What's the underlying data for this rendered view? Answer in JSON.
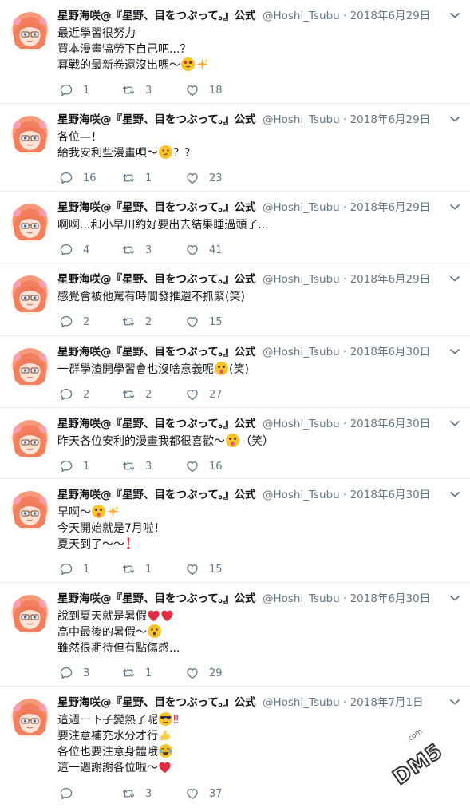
{
  "account": {
    "name": "星野海咲@『星野、目をつぶって。』公式",
    "handle": "@Hoshi_Tsubu",
    "separator": "·"
  },
  "tweets": [
    {
      "date": "2018年6月29日",
      "lines": [
        "最近學習很努力",
        "買本漫畫犒勞下自己吧...？",
        "暮戰的最新卷還沒出嗎～"
      ],
      "line_emojis": [
        [],
        [],
        [
          "heart-eyes-emoji",
          "sparkles-emoji"
        ]
      ],
      "replies": "1",
      "retweets": "3",
      "likes": "18"
    },
    {
      "date": "2018年6月29日",
      "lines": [
        "各位—！",
        "給我安利些漫畫唄～",
        "？？"
      ],
      "replies": "16",
      "retweets": "1",
      "likes": "23"
    },
    {
      "date": "2018年6月29日",
      "lines": [
        "啊啊...和小早川約好要出去結果睡過頭了..."
      ],
      "replies": "4",
      "retweets": "3",
      "likes": "41"
    },
    {
      "date": "2018年6月29日",
      "lines": [
        "感覺會被他罵有時間發推還不抓緊(笑)"
      ],
      "replies": "2",
      "retweets": "2",
      "likes": "15"
    },
    {
      "date": "2018年6月30日",
      "lines": [
        "一群學渣開學習會也沒啥意義呢",
        "(笑)"
      ],
      "replies": "2",
      "retweets": "2",
      "likes": "27"
    },
    {
      "date": "2018年6月30日",
      "lines": [
        "昨天各位安利的漫畫我都很喜歡～",
        "（笑）"
      ],
      "replies": "1",
      "retweets": "3",
      "likes": "16"
    },
    {
      "date": "2018年6月30日",
      "lines": [
        "早啊～",
        "今天開始就是7月啦！",
        "夏天到了～～"
      ],
      "replies": "1",
      "retweets": "1",
      "likes": "15"
    },
    {
      "date": "2018年6月30日",
      "lines": [
        "說到夏天就是暑假",
        "高中最後的暑假～",
        "雖然很期待但有點傷感..."
      ],
      "replies": "3",
      "retweets": "1",
      "likes": "29"
    },
    {
      "date": "2018年7月1日",
      "lines": [
        "這週一下子變熱了呢",
        "‼",
        "要注意補充水分才行",
        "各位也要注意身體哦",
        "這一週謝謝各位啦～"
      ],
      "replies": "",
      "retweets": "3",
      "likes": "37"
    }
  ],
  "watermark": {
    "text": "DM5",
    "small": ".com"
  },
  "colors": {
    "accent": "#1da1f2",
    "muted": "#657786",
    "border": "#e6ecf0",
    "text": "#14171a"
  }
}
